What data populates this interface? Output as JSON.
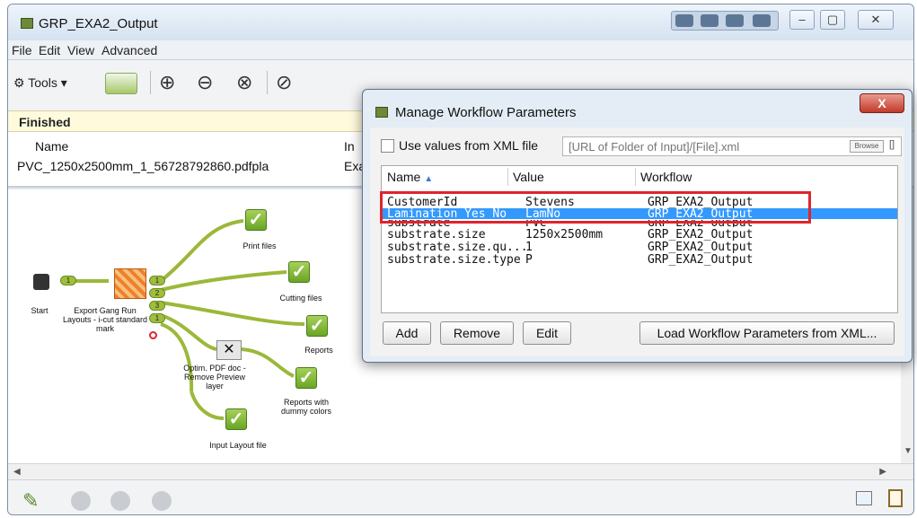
{
  "window": {
    "title": "GRP_EXA2_Output"
  },
  "menubar": {
    "file": "File",
    "edit": "Edit",
    "view": "View",
    "advanced": "Advanced"
  },
  "toolbar": {
    "tools_label": "Tools ▾"
  },
  "status": {
    "text": "Finished"
  },
  "job_table": {
    "headers": {
      "name": "Name",
      "in": "In"
    },
    "row": {
      "name": "PVC_1250x2500mm_1_56728792860.pdfpla",
      "in": "Exa"
    }
  },
  "workflow": {
    "start": "Start",
    "export": "Export Gang Run Layouts - i-cut standard mark",
    "print_files": "Print files",
    "cutting_files": "Cutting files",
    "reports": "Reports",
    "optim": "Optim. PDF doc - Remove Preview layer",
    "reports_dummy": "Reports with dummy colors",
    "input_layout": "Input Layout file",
    "pins": [
      "1",
      "1",
      "2",
      "3",
      "1"
    ]
  },
  "dialog": {
    "title": "Manage Workflow Parameters",
    "close": "X",
    "xml_checkbox_label": "Use values from XML file",
    "xml_path_placeholder": "[URL of Folder of Input]/[File].xml",
    "browse": "Browse",
    "bracket": "[]",
    "table": {
      "headers": {
        "name": "Name",
        "value": "Value",
        "workflow": "Workflow"
      },
      "rows": [
        {
          "name": "CustomerId",
          "value": "Stevens",
          "workflow": "GRP_EXA2_Output"
        },
        {
          "name": "Lamination Yes No",
          "value": "LamNo",
          "workflow": "GRP_EXA2_Output"
        },
        {
          "name": "substrate",
          "value": "PVC",
          "workflow": "GRP_EXA2_Output"
        },
        {
          "name": "substrate.size",
          "value": "1250x2500mm",
          "workflow": "GRP_EXA2_Output"
        },
        {
          "name": "substrate.size.qu...",
          "value": "1",
          "workflow": "GRP_EXA2_Output"
        },
        {
          "name": "substrate.size.type",
          "value": "P",
          "workflow": "GRP_EXA2_Output"
        }
      ],
      "selected_row": 1
    },
    "buttons": {
      "add": "Add",
      "remove": "Remove",
      "edit": "Edit",
      "load": "Load Workflow Parameters from XML..."
    }
  },
  "colors": {
    "selection": "#3399ff",
    "highlight": "#e0242c",
    "status_bg": "#fffadc",
    "check_green": "#7cb82f"
  }
}
